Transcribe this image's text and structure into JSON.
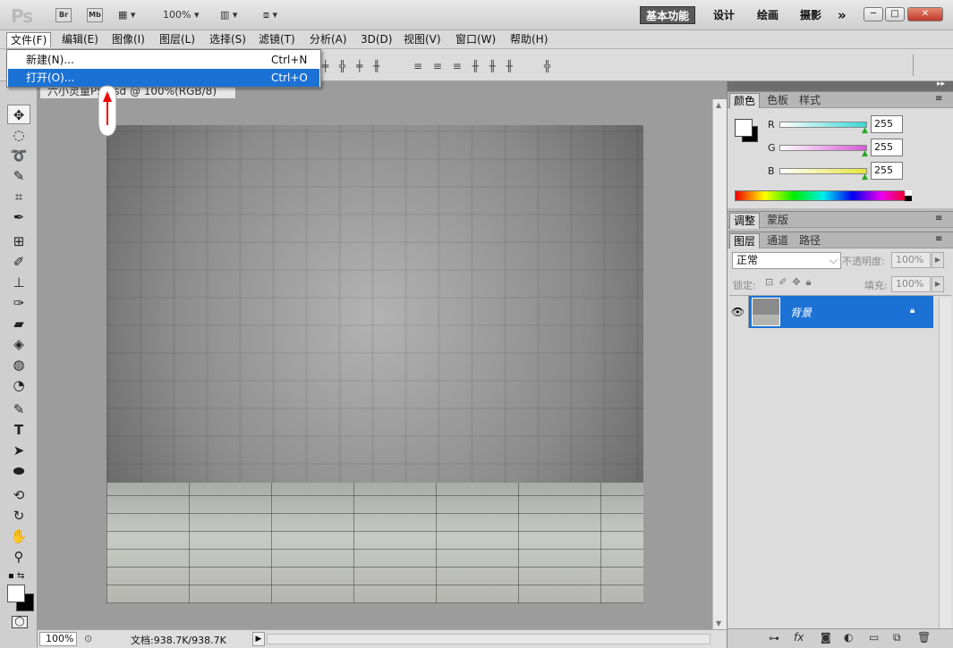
{
  "app": {
    "logo": "Ps",
    "mini_buttons": [
      "Br",
      "Mb"
    ],
    "zoom": "100%"
  },
  "workspaces": {
    "active": "基本功能",
    "items": [
      "设计",
      "绘画",
      "摄影"
    ],
    "more": "»"
  },
  "window_buttons": {
    "minimize": "─",
    "restore": "□",
    "close": "✕"
  },
  "menu": [
    "文件(F)",
    "编辑(E)",
    "图像(I)",
    "图层(L)",
    "选择(S)",
    "滤镜(T)",
    "分析(A)",
    "3D(D)",
    "视图(V)",
    "窗口(W)",
    "帮助(H)"
  ],
  "dropdown": [
    {
      "label": "新建(N)...",
      "shortcut": "Ctrl+N"
    },
    {
      "label": "打开(O)...",
      "shortcut": "Ctrl+O"
    }
  ],
  "document": {
    "tab_title": "六小灵童PS.psd @ 100%(RGB/8)"
  },
  "status": {
    "zoom": "100%",
    "doc_info": "文档:938.7K/938.7K"
  },
  "color_panel": {
    "tabs": [
      "颜色",
      "色板",
      "样式"
    ],
    "channels": [
      {
        "name": "R",
        "value": "255",
        "color": "#3ad6d6"
      },
      {
        "name": "G",
        "value": "255",
        "color": "#d65ad6"
      },
      {
        "name": "B",
        "value": "255",
        "color": "#e6e63a"
      }
    ]
  },
  "adjust_panel": {
    "tabs": [
      "调整",
      "蒙版"
    ]
  },
  "layers_panel": {
    "tabs": [
      "图层",
      "通道",
      "路径"
    ],
    "blend_mode": "正常",
    "opacity_label": "不透明度:",
    "opacity": "100%",
    "lock_label": "锁定:",
    "fill_label": "填充:",
    "fill": "100%",
    "layer_name": "背景"
  },
  "colors": {
    "highlight": "#1c72d4"
  }
}
